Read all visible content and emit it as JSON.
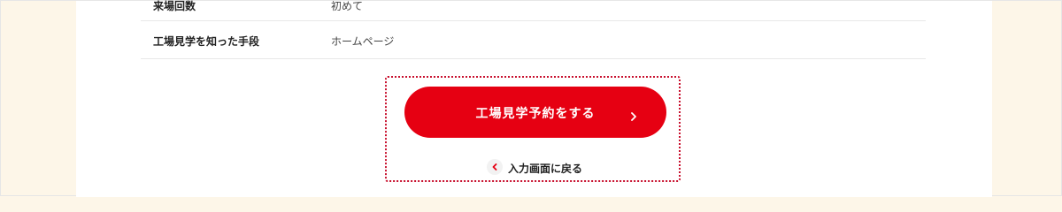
{
  "confirmation": {
    "rows": [
      {
        "label": "来場回数",
        "value": "初めて"
      },
      {
        "label": "工場見学を知った手段",
        "value": "ホームページ"
      }
    ]
  },
  "actions": {
    "submit_label": "工場見学予約をする",
    "back_label": "入力画面に戻る"
  },
  "icons": {
    "submit": "chevron-right-icon",
    "back": "chevron-left-circle-icon"
  },
  "colors": {
    "accent": "#e60012",
    "page_background": "#fdf6e8",
    "focus_outline": "#c8102e"
  }
}
